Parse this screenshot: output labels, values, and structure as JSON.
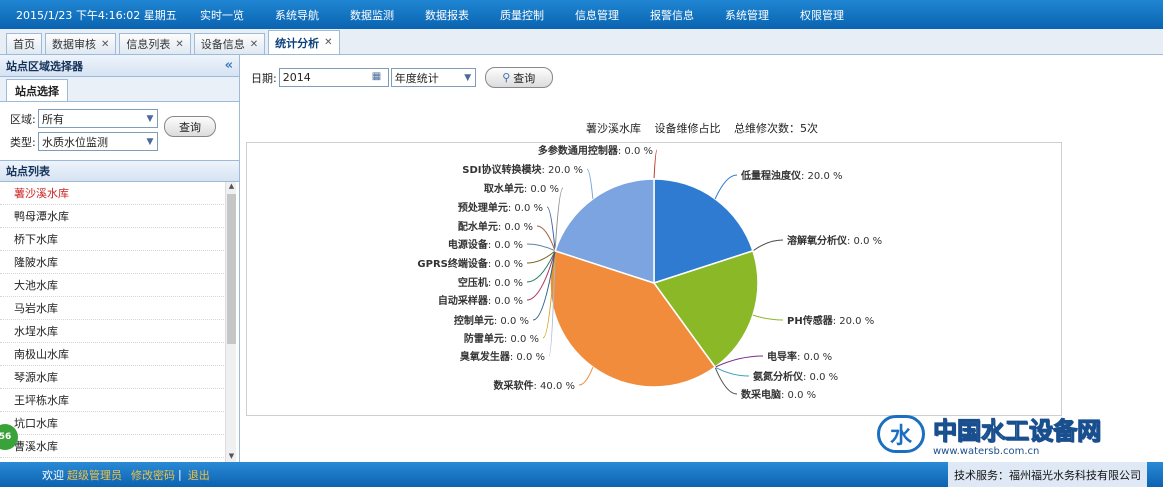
{
  "topbar": {
    "clock": "2015/1/23 下午4:16:02 星期五",
    "menu": [
      "实时一览",
      "系统导航",
      "数据监测",
      "数据报表",
      "质量控制",
      "信息管理",
      "报警信息",
      "系统管理",
      "权限管理"
    ]
  },
  "tabs": [
    {
      "label": "首页",
      "closable": false
    },
    {
      "label": "数据审核",
      "closable": true
    },
    {
      "label": "信息列表",
      "closable": true
    },
    {
      "label": "设备信息",
      "closable": true
    },
    {
      "label": "统计分析",
      "closable": true,
      "active": true
    }
  ],
  "left": {
    "title": "站点区域选择器",
    "subtab": "站点选择",
    "region_label": "区域:",
    "region_value": "所有",
    "type_label": "类型:",
    "type_value": "水质水位监测",
    "query_label": "查询",
    "list_title": "站点列表",
    "stations": [
      "薯沙溪水库",
      "鸭母潭水库",
      "桥下水库",
      "隆陂水库",
      "大池水库",
      "马岩水库",
      "水埕水库",
      "南极山水库",
      "琴源水库",
      "王坪栋水库",
      "坑口水库",
      "曹溪水库"
    ],
    "badge": "56"
  },
  "toolbar": {
    "date_label": "日期:",
    "date_value": "2014",
    "period_value": "年度统计",
    "search_label": "查询"
  },
  "chart_header": {
    "station": "薯沙溪水库",
    "subject": "设备维修占比",
    "total": "总维修次数：5次"
  },
  "chart_data": {
    "type": "pie",
    "slices": [
      {
        "label": "多参数通用控制器",
        "value": 0.0,
        "color": "#c0392b"
      },
      {
        "label": "低量程浊度仪",
        "value": 20.0,
        "color": "#2f7bd1"
      },
      {
        "label": "溶解氧分析仪",
        "value": 0.0,
        "color": "#4a4a4a"
      },
      {
        "label": "PH传感器",
        "value": 20.0,
        "color": "#8ab826"
      },
      {
        "label": "电导率",
        "value": 0.0,
        "color": "#7a2d8a"
      },
      {
        "label": "氨氮分析仪",
        "value": 0.0,
        "color": "#3aa0c8"
      },
      {
        "label": "数采电脑",
        "value": 0.0,
        "color": "#555555"
      },
      {
        "label": "数采软件",
        "value": 40.0,
        "color": "#f08c3c"
      },
      {
        "label": "臭氧发生器",
        "value": 0.0,
        "color": "#aabbdd"
      },
      {
        "label": "防雷单元",
        "value": 0.0,
        "color": "#d4a017"
      },
      {
        "label": "控制单元",
        "value": 0.0,
        "color": "#2b5f8a"
      },
      {
        "label": "自动采样器",
        "value": 0.0,
        "color": "#b03060"
      },
      {
        "label": "空压机",
        "value": 0.0,
        "color": "#208060"
      },
      {
        "label": "GPRS终端设备",
        "value": 0.0,
        "color": "#806020"
      },
      {
        "label": "电源设备",
        "value": 0.0,
        "color": "#6080a0"
      },
      {
        "label": "配水单元",
        "value": 0.0,
        "color": "#a06040"
      },
      {
        "label": "预处理单元",
        "value": 0.0,
        "color": "#4060a0"
      },
      {
        "label": "取水单元",
        "value": 0.0,
        "color": "#909090"
      },
      {
        "label": "SDI协议转换模块",
        "value": 20.0,
        "color": "#7ba4e0"
      }
    ]
  },
  "logo": {
    "mark": "水",
    "name": "中国水工设备网",
    "url": "www.watersb.com.cn"
  },
  "footer": {
    "welcome": "欢迎",
    "user": "超级管理员",
    "link1": "修改密码",
    "sep": "|",
    "link2": "退出",
    "tech": "技术服务：福州福光水务科技有限公司"
  }
}
